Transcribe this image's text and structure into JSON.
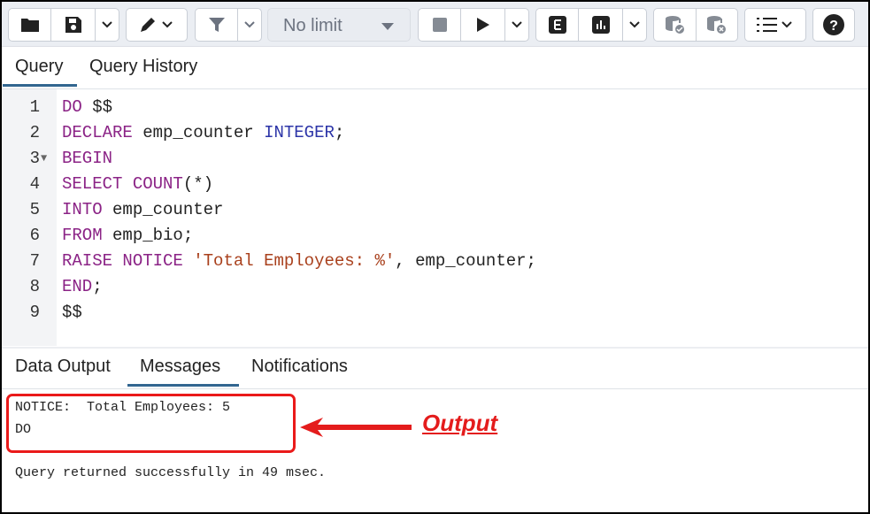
{
  "toolbar": {
    "limit_value": "No limit"
  },
  "query_tabs": [
    {
      "label": "Query",
      "active": true
    },
    {
      "label": "Query History",
      "active": false
    }
  ],
  "editor": {
    "line_numbers": [
      "1",
      "2",
      "3",
      "4",
      "5",
      "6",
      "7",
      "8",
      "9"
    ],
    "fold_marker": "▼",
    "tokens": {
      "l1_kw": "DO",
      "l1_rest": " $$",
      "l2_kw": "DECLARE",
      "l2_mid": " emp_counter ",
      "l2_type": "INTEGER",
      "l2_end": ";",
      "l3_kw": "BEGIN",
      "l4_kw1": "SELECT",
      "l4_sp": " ",
      "l4_kw2": "COUNT",
      "l4_rest": "(*)",
      "l5_kw": "INTO",
      "l5_rest": " emp_counter",
      "l6_kw": "FROM",
      "l6_rest": " emp_bio;",
      "l7_kw1": "RAISE",
      "l7_sp": " ",
      "l7_kw2": "NOTICE",
      "l7_sp2": " ",
      "l7_str": "'Total Employees: %'",
      "l7_rest": ", emp_counter;",
      "l8_kw": "END",
      "l8_rest": ";",
      "l9": "$$"
    }
  },
  "output_tabs": [
    {
      "label": "Data Output",
      "active": false
    },
    {
      "label": "Messages",
      "active": true
    },
    {
      "label": "Notifications",
      "active": false
    }
  ],
  "messages": {
    "notice": "NOTICE:  Total Employees: 5",
    "do": "DO",
    "result": "Query returned successfully in 49 msec."
  },
  "annotation": {
    "label": "Output",
    "color": "#e41c1c"
  },
  "colors": {
    "keyword": "#8b2386",
    "type": "#2d35a8",
    "string": "#a9401c",
    "active_tab": "#326690"
  }
}
